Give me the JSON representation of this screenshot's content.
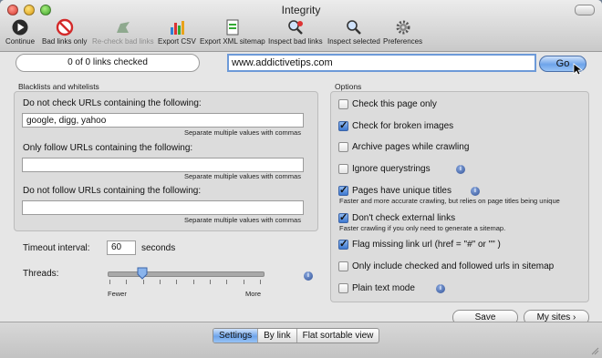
{
  "window": {
    "title": "Integrity"
  },
  "toolbar": {
    "continue": "Continue",
    "bad_links_only": "Bad links only",
    "recheck_bad_links": "Re-check bad links",
    "export_csv": "Export CSV",
    "export_xml_sitemap": "Export XML sitemap",
    "inspect_bad_links": "Inspect bad links",
    "inspect_selected": "Inspect selected",
    "preferences": "Preferences"
  },
  "status": {
    "text": "0 of 0 links checked"
  },
  "url": {
    "value": "www.addictivetips.com"
  },
  "go_label": "Go",
  "blacklists": {
    "title": "Blacklists and whitelists",
    "dont_check_label": "Do not check URLs containing the following:",
    "dont_check_value": "google, digg, yahoo",
    "only_follow_label": "Only follow URLs containing the following:",
    "only_follow_value": "",
    "dont_follow_label": "Do not follow URLs containing the following:",
    "dont_follow_value": "",
    "hint": "Separate multiple values with commas"
  },
  "timeout": {
    "label": "Timeout interval:",
    "value": "60",
    "unit": "seconds"
  },
  "threads": {
    "label": "Threads:",
    "fewer": "Fewer",
    "more": "More",
    "level": 0.22
  },
  "options": {
    "title": "Options",
    "items": [
      {
        "label": "Check this page only",
        "checked": false
      },
      {
        "label": "Check for broken images",
        "checked": true
      },
      {
        "label": "Archive pages while crawling",
        "checked": false
      },
      {
        "label": "Ignore querystrings",
        "checked": false
      },
      {
        "label": "Pages have unique titles",
        "checked": true,
        "hint": "Faster and more accurate crawling, but relies on page titles being unique"
      },
      {
        "label": "Don't check external links",
        "checked": true,
        "hint": "Faster crawling if you only need to generate a sitemap."
      },
      {
        "label": "Flag missing link url (href = \"#\"  or  \"\" )",
        "checked": true
      },
      {
        "label": "Only include checked and followed urls in sitemap",
        "checked": false
      },
      {
        "label": "Plain text mode",
        "checked": false
      }
    ]
  },
  "buttons": {
    "save": "Save",
    "my_sites": "My sites"
  },
  "tabs": [
    {
      "label": "Settings",
      "selected": true
    },
    {
      "label": "By link",
      "selected": false
    },
    {
      "label": "Flat sortable view",
      "selected": false
    }
  ],
  "colors": {
    "accent": "#6ea4ea",
    "window_bg": "#e6e6e6"
  }
}
